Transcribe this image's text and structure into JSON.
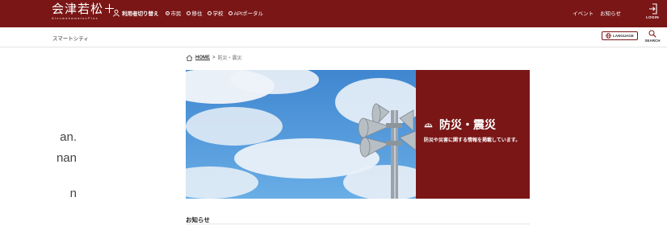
{
  "header": {
    "logo_text": "会津若松＋",
    "logo_sub": "AizuwakamatsuPlus",
    "switch_label": "利用者切り替え",
    "user_types": [
      {
        "label": "市民",
        "checked": true
      },
      {
        "label": "移住",
        "checked": false
      },
      {
        "label": "学校",
        "checked": false
      },
      {
        "label": "APIポータル",
        "checked": false
      }
    ],
    "links": [
      "イベント",
      "お知らせ"
    ],
    "login_label": "LOGIN"
  },
  "subheader": {
    "site_name": "スマートシティ",
    "language_label": "LANGUAGE",
    "search_label": "SEARCH"
  },
  "breadcrumb": {
    "home": "HOME",
    "separator": ">",
    "current": "防災・震災"
  },
  "hero": {
    "title": "防災・震災",
    "description": "防災や災害に関する情報を掲載しています。",
    "icon": "helmet-icon"
  },
  "side_text": [
    "an.",
    "nan",
    "n"
  ],
  "news": {
    "heading": "お知らせ"
  },
  "colors": {
    "brand": "#7a1616",
    "sky": "#4a8fd4"
  }
}
